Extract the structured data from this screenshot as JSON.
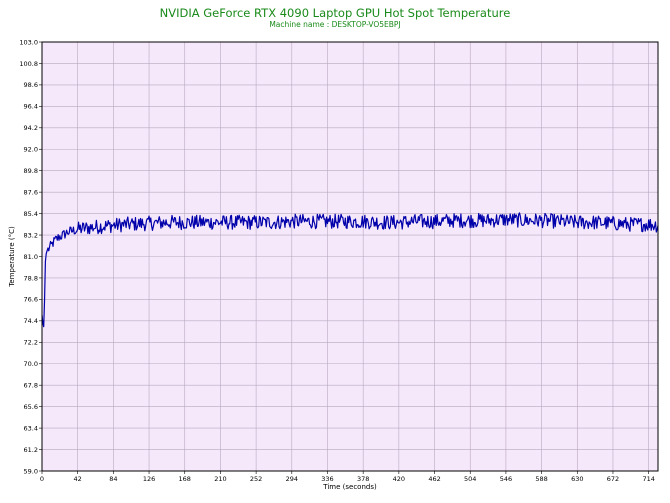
{
  "chart_data": {
    "type": "line",
    "title": "NVIDIA GeForce RTX 4090 Laptop GPU Hot Spot Temperature",
    "subtitle": "Machine name : DESKTOP-VO5EBPJ",
    "xlabel": "Time (seconds)",
    "ylabel": "Temperature (°C)",
    "xlim": [
      0,
      725
    ],
    "ylim": [
      59.0,
      103.0
    ],
    "x_ticks": [
      "0",
      "42",
      "84",
      "126",
      "168",
      "210",
      "252",
      "294",
      "336",
      "378",
      "420",
      "462",
      "504",
      "546",
      "588",
      "630",
      "672",
      "714"
    ],
    "y_ticks": [
      "103.0",
      "100.8",
      "98.6",
      "96.4",
      "94.2",
      "92.0",
      "89.8",
      "87.6",
      "85.4",
      "83.2",
      "81.0",
      "78.8",
      "76.6",
      "74.4",
      "72.2",
      "70.0",
      "67.8",
      "65.6",
      "63.4",
      "61.2",
      "59.0"
    ],
    "grid": true,
    "series": [
      {
        "color": "#0000aa",
        "x": [
          0,
          1,
          2,
          3,
          4,
          5,
          6,
          8,
          10,
          13,
          16,
          20,
          25,
          30,
          35,
          42,
          50,
          60,
          70,
          84,
          100,
          126,
          150,
          168,
          190,
          210,
          230,
          252,
          270,
          294,
          315,
          336,
          357,
          378,
          400,
          420,
          440,
          462,
          484,
          504,
          525,
          546,
          567,
          588,
          609,
          630,
          651,
          672,
          693,
          714,
          725
        ],
        "values": [
          75.0,
          74.2,
          73.8,
          76.5,
          80.5,
          81.3,
          81.6,
          81.8,
          82.0,
          82.4,
          82.7,
          83.0,
          83.2,
          83.5,
          83.6,
          83.8,
          83.9,
          84.0,
          84.1,
          84.2,
          84.3,
          84.4,
          84.5,
          84.5,
          84.5,
          84.5,
          84.5,
          84.5,
          84.5,
          84.6,
          84.6,
          84.6,
          84.6,
          84.6,
          84.5,
          84.5,
          84.6,
          84.6,
          84.7,
          84.7,
          84.7,
          84.8,
          84.7,
          84.7,
          84.6,
          84.5,
          84.5,
          84.4,
          84.3,
          84.3,
          84.2
        ]
      }
    ],
    "colors": {
      "title": "#1a8a1a",
      "plot_background": "#f6e8fb",
      "grid": "#b8a8c0",
      "line": "#0000aa"
    }
  }
}
